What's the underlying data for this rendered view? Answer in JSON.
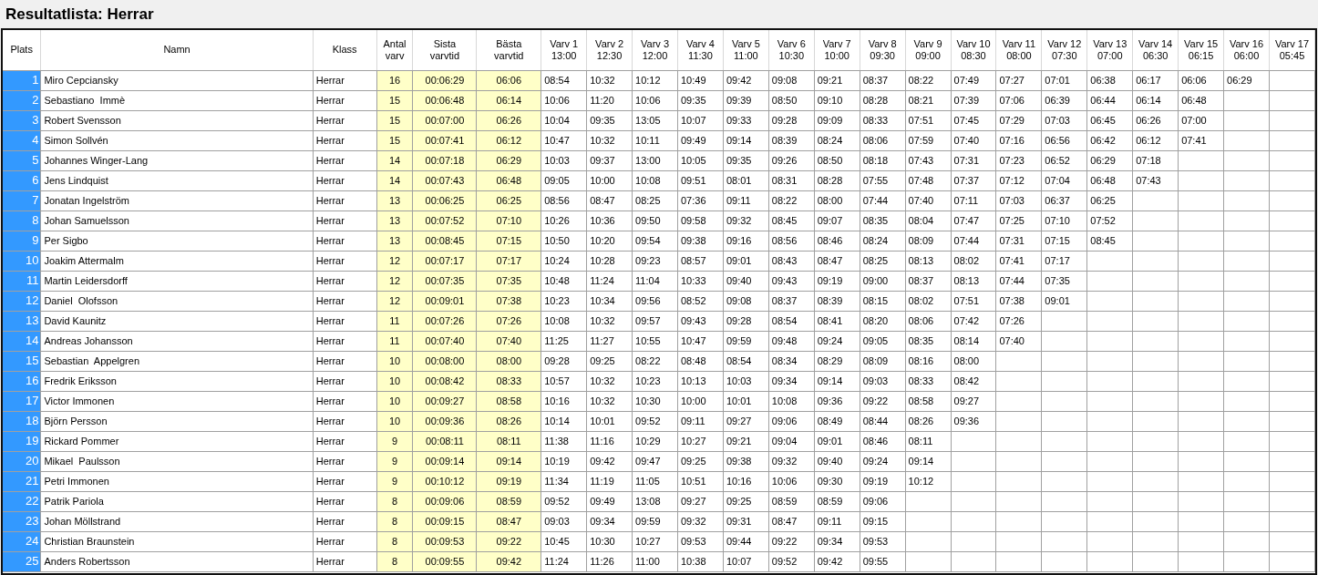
{
  "title": "Resultatlista: Herrar",
  "table": {
    "columns": [
      {
        "label": "Plats"
      },
      {
        "label": "Namn"
      },
      {
        "label": "Klass"
      },
      {
        "label": "Antal\nvarv"
      },
      {
        "label": "Sista\nvarvtid"
      },
      {
        "label": "Bästa\nvarvtid"
      },
      {
        "label": "Varv 1\n13:00"
      },
      {
        "label": "Varv 2\n12:30"
      },
      {
        "label": "Varv 3\n12:00"
      },
      {
        "label": "Varv 4\n11:30"
      },
      {
        "label": "Varv 5\n11:00"
      },
      {
        "label": "Varv 6\n10:30"
      },
      {
        "label": "Varv 7\n10:00"
      },
      {
        "label": "Varv 8\n09:30"
      },
      {
        "label": "Varv 9\n09:00"
      },
      {
        "label": "Varv 10\n08:30"
      },
      {
        "label": "Varv 11\n08:00"
      },
      {
        "label": "Varv 12\n07:30"
      },
      {
        "label": "Varv 13\n07:00"
      },
      {
        "label": "Varv 14\n06:30"
      },
      {
        "label": "Varv 15\n06:15"
      },
      {
        "label": "Varv 16\n06:00"
      },
      {
        "label": "Varv 17\n05:45"
      }
    ],
    "rows": [
      {
        "plats": "1",
        "namn": "Miro Cepciansky",
        "klass": "Herrar",
        "antal": "16",
        "sista": "00:06:29",
        "basta": "06:06",
        "laps": [
          "08:54",
          "10:32",
          "10:12",
          "10:49",
          "09:42",
          "09:08",
          "09:21",
          "08:37",
          "08:22",
          "07:49",
          "07:27",
          "07:01",
          "06:38",
          "06:17",
          "06:06",
          "06:29"
        ]
      },
      {
        "plats": "2",
        "namn": "Sebastiano  Immè",
        "klass": "Herrar",
        "antal": "15",
        "sista": "00:06:48",
        "basta": "06:14",
        "laps": [
          "10:06",
          "11:20",
          "10:06",
          "09:35",
          "09:39",
          "08:50",
          "09:10",
          "08:28",
          "08:21",
          "07:39",
          "07:06",
          "06:39",
          "06:44",
          "06:14",
          "06:48"
        ]
      },
      {
        "plats": "3",
        "namn": "Robert Svensson",
        "klass": "Herrar",
        "antal": "15",
        "sista": "00:07:00",
        "basta": "06:26",
        "laps": [
          "10:04",
          "09:35",
          "13:05",
          "10:07",
          "09:33",
          "09:28",
          "09:09",
          "08:33",
          "07:51",
          "07:45",
          "07:29",
          "07:03",
          "06:45",
          "06:26",
          "07:00"
        ]
      },
      {
        "plats": "4",
        "namn": "Simon Sollvén",
        "klass": "Herrar",
        "antal": "15",
        "sista": "00:07:41",
        "basta": "06:12",
        "laps": [
          "10:47",
          "10:32",
          "10:11",
          "09:49",
          "09:14",
          "08:39",
          "08:24",
          "08:06",
          "07:59",
          "07:40",
          "07:16",
          "06:56",
          "06:42",
          "06:12",
          "07:41"
        ]
      },
      {
        "plats": "5",
        "namn": "Johannes Winger-Lang",
        "klass": "Herrar",
        "antal": "14",
        "sista": "00:07:18",
        "basta": "06:29",
        "laps": [
          "10:03",
          "09:37",
          "13:00",
          "10:05",
          "09:35",
          "09:26",
          "08:50",
          "08:18",
          "07:43",
          "07:31",
          "07:23",
          "06:52",
          "06:29",
          "07:18"
        ]
      },
      {
        "plats": "6",
        "namn": "Jens Lindquist",
        "klass": "Herrar",
        "antal": "14",
        "sista": "00:07:43",
        "basta": "06:48",
        "laps": [
          "09:05",
          "10:00",
          "10:08",
          "09:51",
          "08:01",
          "08:31",
          "08:28",
          "07:55",
          "07:48",
          "07:37",
          "07:12",
          "07:04",
          "06:48",
          "07:43"
        ]
      },
      {
        "plats": "7",
        "namn": "Jonatan Ingelström",
        "klass": "Herrar",
        "antal": "13",
        "sista": "00:06:25",
        "basta": "06:25",
        "laps": [
          "08:56",
          "08:47",
          "08:25",
          "07:36",
          "09:11",
          "08:22",
          "08:00",
          "07:44",
          "07:40",
          "07:11",
          "07:03",
          "06:37",
          "06:25"
        ]
      },
      {
        "plats": "8",
        "namn": "Johan Samuelsson",
        "klass": "Herrar",
        "antal": "13",
        "sista": "00:07:52",
        "basta": "07:10",
        "laps": [
          "10:26",
          "10:36",
          "09:50",
          "09:58",
          "09:32",
          "08:45",
          "09:07",
          "08:35",
          "08:04",
          "07:47",
          "07:25",
          "07:10",
          "07:52"
        ]
      },
      {
        "plats": "9",
        "namn": "Per Sigbo",
        "klass": "Herrar",
        "antal": "13",
        "sista": "00:08:45",
        "basta": "07:15",
        "laps": [
          "10:50",
          "10:20",
          "09:54",
          "09:38",
          "09:16",
          "08:56",
          "08:46",
          "08:24",
          "08:09",
          "07:44",
          "07:31",
          "07:15",
          "08:45"
        ]
      },
      {
        "plats": "10",
        "namn": "Joakim Attermalm",
        "klass": "Herrar",
        "antal": "12",
        "sista": "00:07:17",
        "basta": "07:17",
        "laps": [
          "10:24",
          "10:28",
          "09:23",
          "08:57",
          "09:01",
          "08:43",
          "08:47",
          "08:25",
          "08:13",
          "08:02",
          "07:41",
          "07:17"
        ]
      },
      {
        "plats": "11",
        "namn": "Martin Leidersdorff",
        "klass": "Herrar",
        "antal": "12",
        "sista": "00:07:35",
        "basta": "07:35",
        "laps": [
          "10:48",
          "11:24",
          "11:04",
          "10:33",
          "09:40",
          "09:43",
          "09:19",
          "09:00",
          "08:37",
          "08:13",
          "07:44",
          "07:35"
        ]
      },
      {
        "plats": "12",
        "namn": "Daniel  Olofsson",
        "klass": "Herrar",
        "antal": "12",
        "sista": "00:09:01",
        "basta": "07:38",
        "laps": [
          "10:23",
          "10:34",
          "09:56",
          "08:52",
          "09:08",
          "08:37",
          "08:39",
          "08:15",
          "08:02",
          "07:51",
          "07:38",
          "09:01"
        ]
      },
      {
        "plats": "13",
        "namn": "David Kaunitz",
        "klass": "Herrar",
        "antal": "11",
        "sista": "00:07:26",
        "basta": "07:26",
        "laps": [
          "10:08",
          "10:32",
          "09:57",
          "09:43",
          "09:28",
          "08:54",
          "08:41",
          "08:20",
          "08:06",
          "07:42",
          "07:26"
        ]
      },
      {
        "plats": "14",
        "namn": "Andreas Johansson",
        "klass": "Herrar",
        "antal": "11",
        "sista": "00:07:40",
        "basta": "07:40",
        "laps": [
          "11:25",
          "11:27",
          "10:55",
          "10:47",
          "09:59",
          "09:48",
          "09:24",
          "09:05",
          "08:35",
          "08:14",
          "07:40"
        ]
      },
      {
        "plats": "15",
        "namn": "Sebastian  Appelgren",
        "klass": "Herrar",
        "antal": "10",
        "sista": "00:08:00",
        "basta": "08:00",
        "laps": [
          "09:28",
          "09:25",
          "08:22",
          "08:48",
          "08:54",
          "08:34",
          "08:29",
          "08:09",
          "08:16",
          "08:00"
        ]
      },
      {
        "plats": "16",
        "namn": "Fredrik Eriksson",
        "klass": "Herrar",
        "antal": "10",
        "sista": "00:08:42",
        "basta": "08:33",
        "laps": [
          "10:57",
          "10:32",
          "10:23",
          "10:13",
          "10:03",
          "09:34",
          "09:14",
          "09:03",
          "08:33",
          "08:42"
        ]
      },
      {
        "plats": "17",
        "namn": "Victor Immonen",
        "klass": "Herrar",
        "antal": "10",
        "sista": "00:09:27",
        "basta": "08:58",
        "laps": [
          "10:16",
          "10:32",
          "10:30",
          "10:00",
          "10:01",
          "10:08",
          "09:36",
          "09:22",
          "08:58",
          "09:27"
        ]
      },
      {
        "plats": "18",
        "namn": "Björn Persson",
        "klass": "Herrar",
        "antal": "10",
        "sista": "00:09:36",
        "basta": "08:26",
        "laps": [
          "10:14",
          "10:01",
          "09:52",
          "09:11",
          "09:27",
          "09:06",
          "08:49",
          "08:44",
          "08:26",
          "09:36"
        ]
      },
      {
        "plats": "19",
        "namn": "Rickard Pommer",
        "klass": "Herrar",
        "antal": "9",
        "sista": "00:08:11",
        "basta": "08:11",
        "laps": [
          "11:38",
          "11:16",
          "10:29",
          "10:27",
          "09:21",
          "09:04",
          "09:01",
          "08:46",
          "08:11"
        ]
      },
      {
        "plats": "20",
        "namn": "Mikael  Paulsson",
        "klass": "Herrar",
        "antal": "9",
        "sista": "00:09:14",
        "basta": "09:14",
        "laps": [
          "10:19",
          "09:42",
          "09:47",
          "09:25",
          "09:38",
          "09:32",
          "09:40",
          "09:24",
          "09:14"
        ]
      },
      {
        "plats": "21",
        "namn": "Petri Immonen",
        "klass": "Herrar",
        "antal": "9",
        "sista": "00:10:12",
        "basta": "09:19",
        "laps": [
          "11:34",
          "11:19",
          "11:05",
          "10:51",
          "10:16",
          "10:06",
          "09:30",
          "09:19",
          "10:12"
        ]
      },
      {
        "plats": "22",
        "namn": "Patrik Pariola",
        "klass": "Herrar",
        "antal": "8",
        "sista": "00:09:06",
        "basta": "08:59",
        "laps": [
          "09:52",
          "09:49",
          "13:08",
          "09:27",
          "09:25",
          "08:59",
          "08:59",
          "09:06"
        ]
      },
      {
        "plats": "23",
        "namn": "Johan Möllstrand",
        "klass": "Herrar",
        "antal": "8",
        "sista": "00:09:15",
        "basta": "08:47",
        "laps": [
          "09:03",
          "09:34",
          "09:59",
          "09:32",
          "09:31",
          "08:47",
          "09:11",
          "09:15"
        ]
      },
      {
        "plats": "24",
        "namn": "Christian Braunstein",
        "klass": "Herrar",
        "antal": "8",
        "sista": "00:09:53",
        "basta": "09:22",
        "laps": [
          "10:45",
          "10:30",
          "10:27",
          "09:53",
          "09:44",
          "09:22",
          "09:34",
          "09:53"
        ]
      },
      {
        "plats": "25",
        "namn": "Anders Robertsson",
        "klass": "Herrar",
        "antal": "8",
        "sista": "00:09:55",
        "basta": "09:42",
        "laps": [
          "11:24",
          "11:26",
          "11:00",
          "10:38",
          "10:07",
          "09:52",
          "09:42",
          "09:55"
        ]
      }
    ]
  }
}
